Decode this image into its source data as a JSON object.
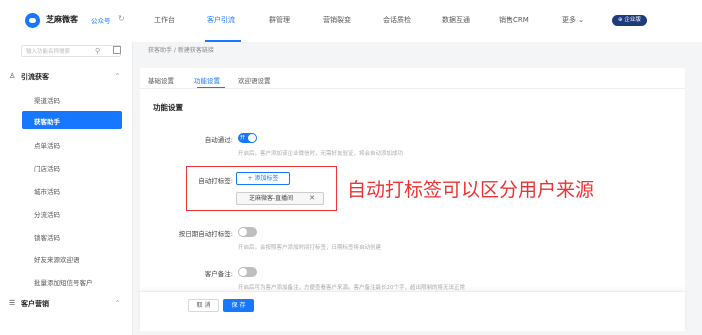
{
  "topbar": {
    "brand": "芝麻微客",
    "account": "公众号",
    "nav": [
      "工作台",
      "客户引流",
      "群管理",
      "营销裂变",
      "会话质检",
      "数据互通",
      "销售CRM",
      "更多 ⌄"
    ],
    "badge": "⊕ 企业版"
  },
  "sidebar": {
    "search_placeholder": "输入功能名称搜索",
    "group1": "引流获客",
    "group2": "客户营销",
    "items": [
      "渠道活码",
      "获客助手",
      "点单活码",
      "门店活码",
      "城市活码",
      "分流活码",
      "锁客活码",
      "好友来源欢迎语",
      "批量添加短信号客户"
    ]
  },
  "breadcrumb": "获客助手  /  新建获客链接",
  "tabs": [
    "基础设置",
    "功能设置",
    "欢迎语设置"
  ],
  "section_title": "功能设置",
  "form": {
    "auto_pass_label": "自动通过:",
    "auto_pass_switch": "开",
    "auto_pass_hint": "开启后，客户添加该企业微信时，无需好友验证，将会自动添加成功",
    "auto_tag_label": "自动打标签:",
    "add_tag_button": "+ 添加标签",
    "tag_value": "芝麻微客-直播间",
    "by_date_label": "按日期自动打标签:",
    "by_date_hint": "开启后，会按照客户添加时间打标签，日期标签将自动创建",
    "remark_label": "客户备注:",
    "remark_hint": "开启后可为客户添加备注，方便查看客户来源。客户备注最长20个字，超出限制的将无法正常"
  },
  "annotation": "自动打标签可以区分用户来源",
  "footer": {
    "cancel": "取 消",
    "save": "保 存"
  },
  "colors": {
    "accent": "#1777ff",
    "annotation": "#e33333"
  }
}
